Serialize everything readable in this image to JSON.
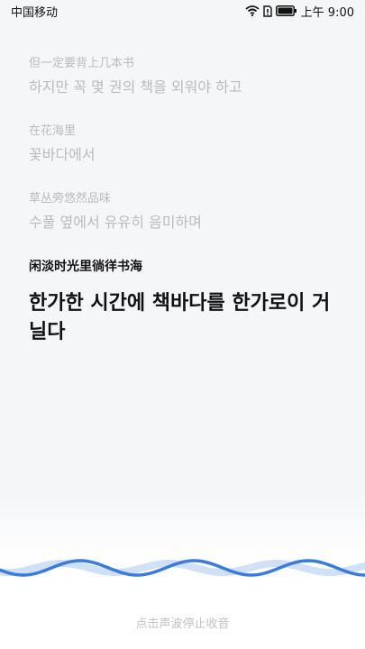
{
  "status_bar": {
    "carrier": "中国移动",
    "time": "上午 9:00"
  },
  "entries": [
    {
      "source": "但一定要背上几本书",
      "translation": "하지만 꼭 몇 권의 책을 외워야 하고"
    },
    {
      "source": "在花海里",
      "translation": "꽃바다에서"
    },
    {
      "source": "草丛旁悠然品味",
      "translation": "수풀 옆에서 유유히 음미하며"
    }
  ],
  "active": {
    "source": "闲淡时光里徜徉书海",
    "translation": "한가한 시간에 책바다를 한가로이 거닐다"
  },
  "footer": {
    "stop_label": "点击声波停止收音"
  },
  "colors": {
    "wave_primary": "#3a7be0",
    "wave_secondary": "#cfe0f7"
  }
}
